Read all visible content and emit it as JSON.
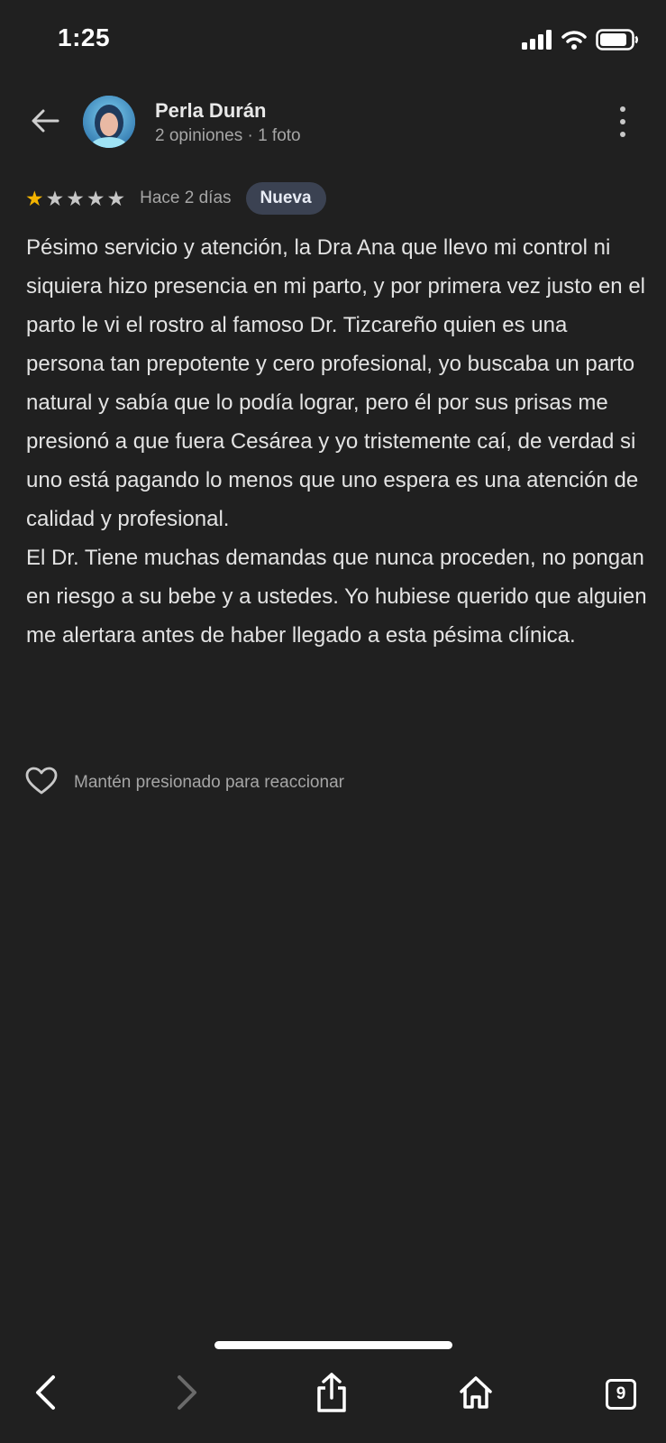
{
  "status_bar": {
    "time": "1:25",
    "icons": [
      "signal-icon",
      "wifi-icon",
      "battery-icon"
    ]
  },
  "header": {
    "back_icon": "arrow-left-icon",
    "user_name": "Perla Durán",
    "user_meta": "2 opiniones · 1 foto",
    "more_icon": "more-vertical-icon"
  },
  "review": {
    "rating": 1,
    "max_rating": 5,
    "date": "Hace 2 días",
    "badge": "Nueva",
    "text": "Pésimo servicio y atención, la Dra Ana que llevo mi control ni siquiera hizo presencia en mi parto, y por primera vez justo en el parto le vi el rostro al famoso Dr. Tizcareño quien es una persona tan prepotente y cero profesional, yo buscaba un parto natural y sabía que lo podía lograr, pero él por sus prisas me presionó a que fuera Cesárea y yo tristemente caí, de verdad si uno está pagando lo menos que uno espera es una atención de calidad y profesional.\nEl Dr. Tiene muchas demandas que nunca proceden, no pongan en riesgo a su bebe y a ustedes. Yo hubiese querido que alguien me alertara antes de haber llegado a esta pésima clínica."
  },
  "reaction": {
    "icon": "heart-outline-icon",
    "label": "Mantén presionado para reaccionar"
  },
  "toolbar": {
    "tab_count": "9",
    "icons": [
      "chevron-left-icon",
      "chevron-right-icon",
      "share-icon",
      "home-icon",
      "tabs-icon"
    ]
  },
  "colors": {
    "background": "#202020",
    "star_filled": "#f4b400",
    "star_empty": "#c7c7c7",
    "badge_bg": "#3b4252"
  }
}
